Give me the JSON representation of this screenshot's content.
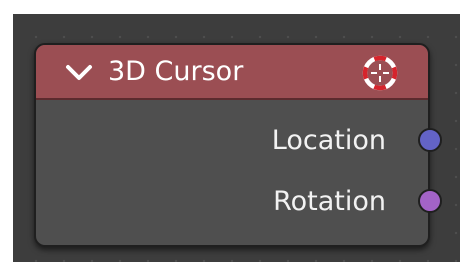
{
  "node": {
    "title": "3D Cursor",
    "header_color": "#9b4e53",
    "collapse_icon": "chevron-down-icon",
    "header_icon": "cursor-crosshair-icon",
    "outputs": [
      {
        "label": "Location",
        "socket_color": "#6363c7"
      },
      {
        "label": "Rotation",
        "socket_color": "#a363c7"
      }
    ]
  }
}
